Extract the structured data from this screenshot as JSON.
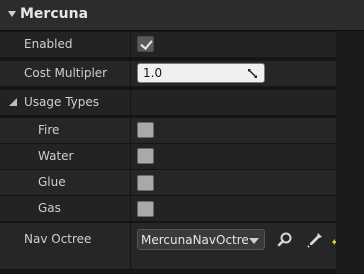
{
  "header": {
    "title": "Mercuna"
  },
  "properties": {
    "enabled": {
      "label": "Enabled",
      "checked": true
    },
    "cost_multiplier": {
      "label": "Cost Multipler",
      "value": "1.0"
    },
    "usage_types": {
      "label": "Usage Types",
      "items": [
        {
          "label": "Fire",
          "checked": false
        },
        {
          "label": "Water",
          "checked": false
        },
        {
          "label": "Glue",
          "checked": false
        },
        {
          "label": "Gas",
          "checked": false
        }
      ]
    },
    "nav_octree": {
      "label": "Nav Octree",
      "value": "MercunaNavOctree"
    }
  },
  "icons": {
    "browse": "magnifier-icon",
    "pick": "eyedropper-icon",
    "use_selected": "use-selected-arrow-icon"
  },
  "colors": {
    "accent_use": "#d9c93a",
    "field_bg": "#f0f0f0",
    "header_bg": "#2c2c2c"
  }
}
